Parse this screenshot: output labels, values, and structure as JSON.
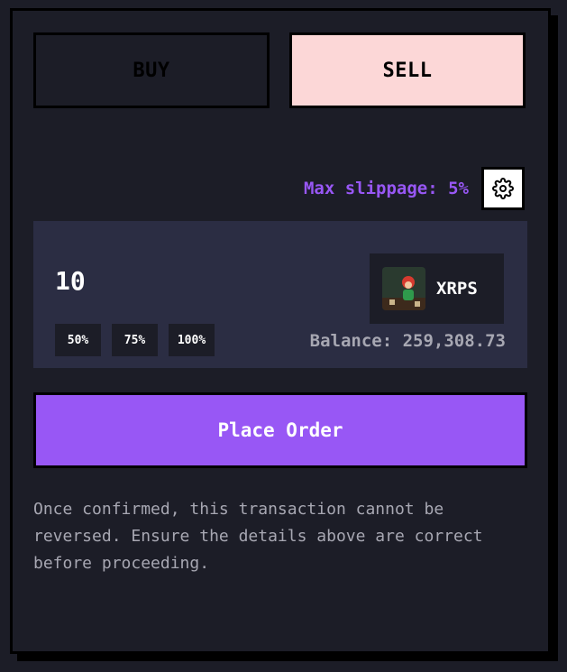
{
  "tabs": {
    "buy_label": "BUY",
    "sell_label": "SELL",
    "active": "SELL"
  },
  "slippage": {
    "label": "Max slippage: 5%"
  },
  "order": {
    "amount": "10",
    "presets": [
      "50%",
      "75%",
      "100%"
    ],
    "token_symbol": "XRPS",
    "token_icon": "xrps-token-icon",
    "balance": "Balance: 259,308.73"
  },
  "place_order_label": "Place Order",
  "disclaimer": "Once confirmed, this transaction cannot be reversed. Ensure the details above are correct before proceeding.",
  "colors": {
    "background": "#1c1d27",
    "accent": "#9857f5",
    "sell_active": "#fcd7d7",
    "input_bg": "#2b2d43",
    "muted_text": "#a7a7b2"
  }
}
